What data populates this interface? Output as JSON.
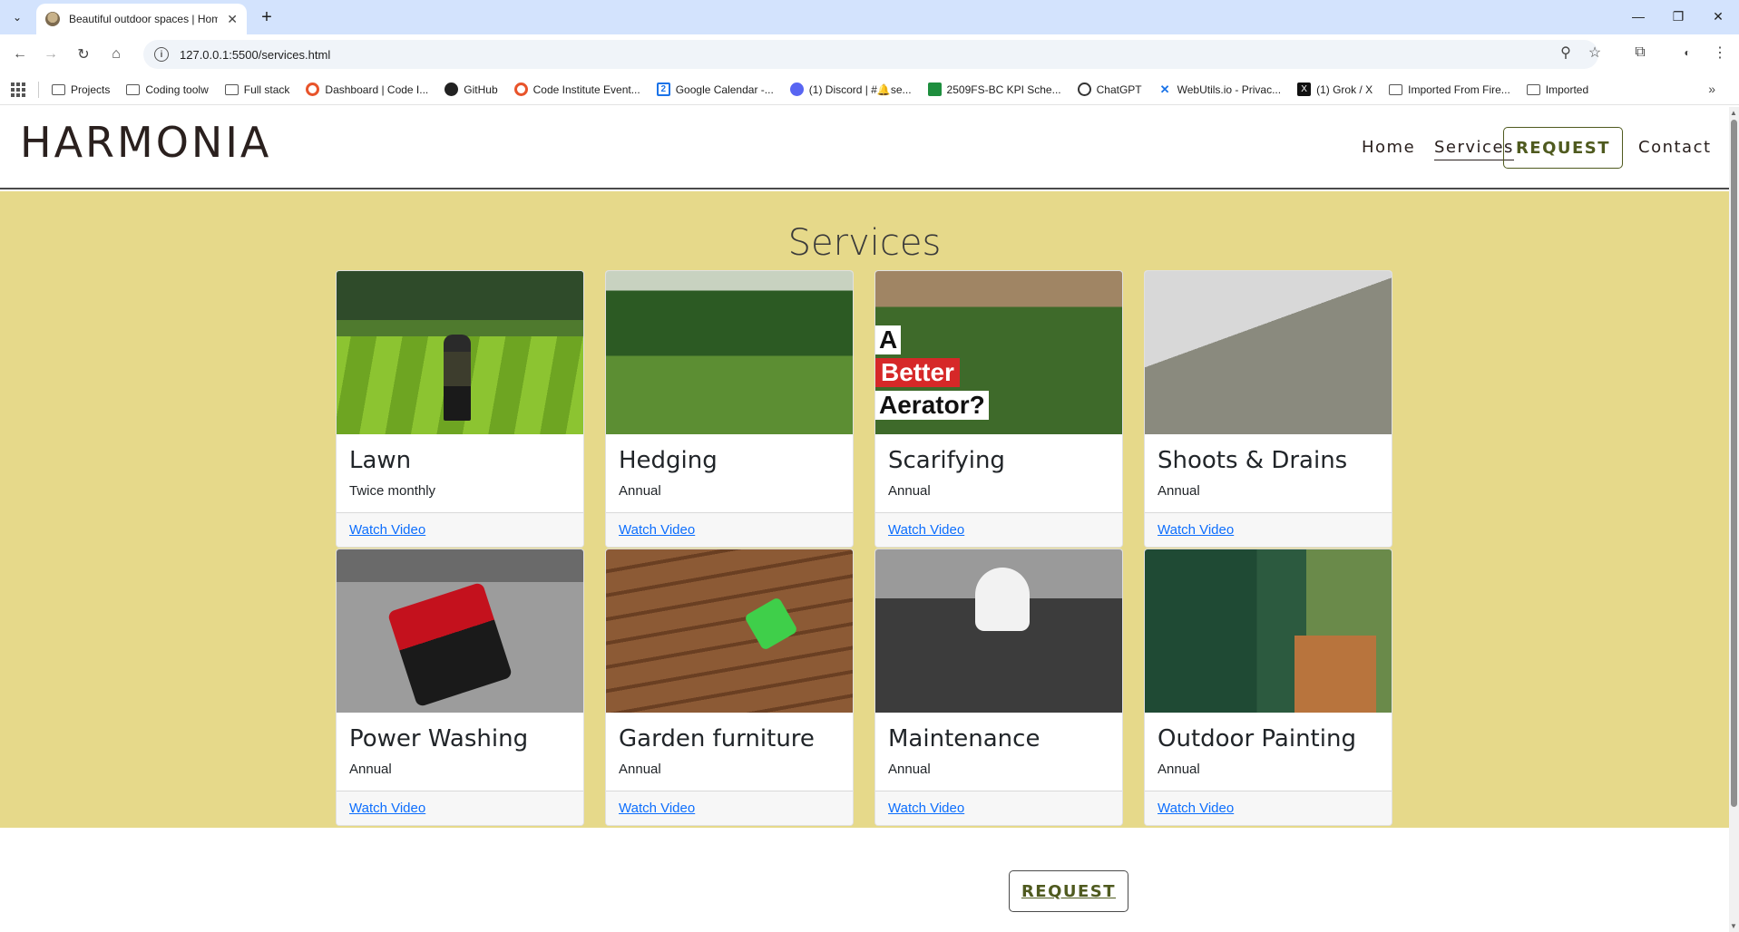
{
  "browser": {
    "tab": {
      "title": "Beautiful outdoor spaces | Hom",
      "close": "✕"
    },
    "new_tab": "+",
    "window_controls": {
      "minimize": "—",
      "maximize": "❐",
      "close": "✕"
    },
    "url": "127.0.0.1:5500/services.html",
    "bookmarks": [
      {
        "label": "Projects",
        "icon": "folder-icon"
      },
      {
        "label": "Coding toolw",
        "icon": "folder-icon"
      },
      {
        "label": "Full stack",
        "icon": "folder-icon"
      },
      {
        "label": "Dashboard | Code I...",
        "icon": "code-institute-icon"
      },
      {
        "label": "GitHub",
        "icon": "github-icon"
      },
      {
        "label": "Code Institute Event...",
        "icon": "code-institute-icon"
      },
      {
        "label": "Google Calendar -...",
        "icon": "calendar-icon"
      },
      {
        "label": "(1) Discord | #🔔se...",
        "icon": "discord-icon"
      },
      {
        "label": "2509FS-BC KPI Sche...",
        "icon": "sheets-icon"
      },
      {
        "label": "ChatGPT",
        "icon": "chatgpt-icon"
      },
      {
        "label": "WebUtils.io - Privac...",
        "icon": "webutils-icon"
      },
      {
        "label": "(1) Grok / X",
        "icon": "x-icon"
      },
      {
        "label": "Imported From Fire...",
        "icon": "folder-icon"
      },
      {
        "label": "Imported",
        "icon": "folder-icon"
      }
    ]
  },
  "site": {
    "logo": "HARMONIA",
    "nav": {
      "home": "Home",
      "services": "Services",
      "request": "REQUEST",
      "contact": "Contact"
    },
    "section_title": "Services",
    "cards": [
      {
        "title": "Lawn",
        "freq": "Twice monthly",
        "link": "Watch Video"
      },
      {
        "title": "Hedging",
        "freq": "Annual",
        "link": "Watch Video"
      },
      {
        "title": "Scarifying",
        "freq": "Annual",
        "link": "Watch Video",
        "overlay": [
          "A",
          "Better",
          "Aerator?"
        ]
      },
      {
        "title": "Shoots & Drains",
        "freq": "Annual",
        "link": "Watch Video"
      },
      {
        "title": "Power Washing",
        "freq": "Annual",
        "link": "Watch Video"
      },
      {
        "title": "Garden furniture",
        "freq": "Annual",
        "link": "Watch Video"
      },
      {
        "title": "Maintenance",
        "freq": "Annual",
        "link": "Watch Video"
      },
      {
        "title": "Outdoor Painting",
        "freq": "Annual",
        "link": "Watch Video"
      }
    ],
    "bottom_request": "REQUEST"
  },
  "colors": {
    "section_bg": "#e6d98a",
    "accent": "#4f5a1f",
    "link": "#0d6efd"
  }
}
